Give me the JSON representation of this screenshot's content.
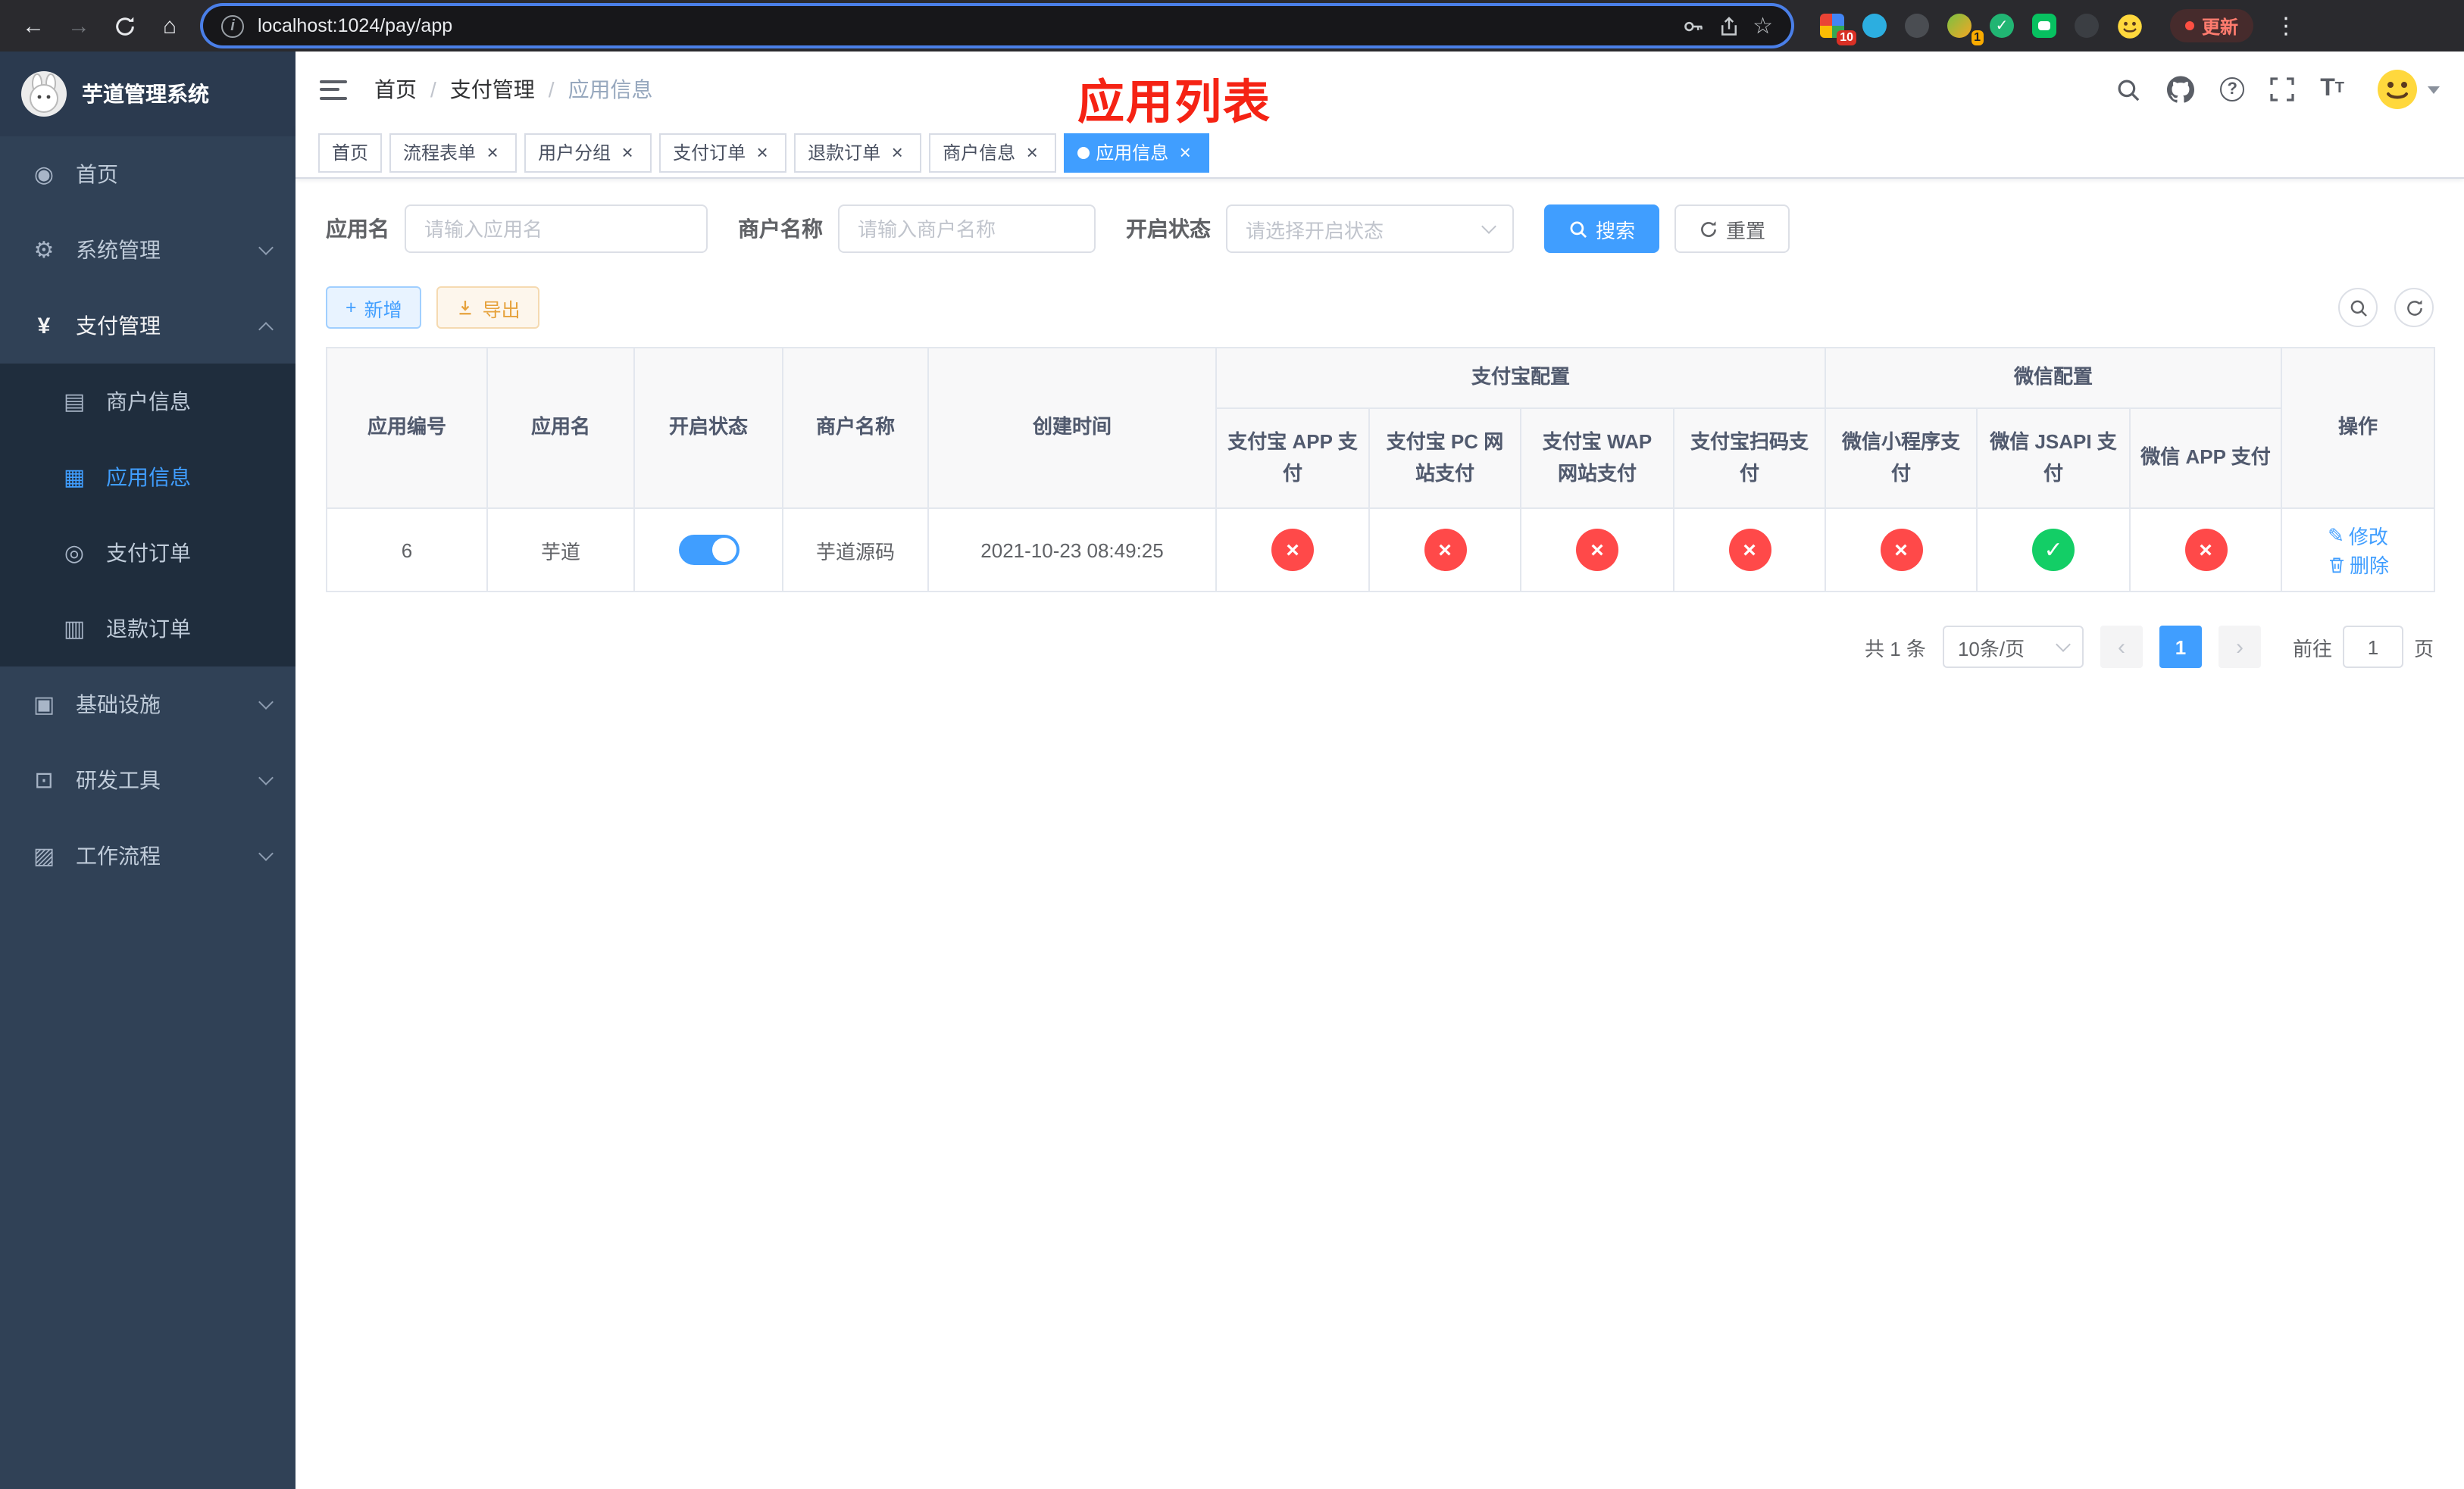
{
  "colors": {
    "accent": "#409eff",
    "danger": "#ff4949",
    "success": "#13ce66",
    "annotation_red": "#f52314",
    "sidebar_bg": "#304156"
  },
  "browser": {
    "url": "localhost:1024/pay/app",
    "update_label": "更新",
    "extension_badge_count": "10",
    "avatar_badge_count": "1"
  },
  "sidebar": {
    "title": "芋道管理系统",
    "home": "首页",
    "system": "系统管理",
    "payment": "支付管理",
    "merchant_info": "商户信息",
    "app_info": "应用信息",
    "pay_order": "支付订单",
    "refund_order": "退款订单",
    "infra": "基础设施",
    "dev_tools": "研发工具",
    "workflow": "工作流程"
  },
  "header": {
    "breadcrumb": [
      "首页",
      "支付管理",
      "应用信息"
    ],
    "annotation": "应用列表"
  },
  "tabs": [
    {
      "label": "首页",
      "closable": false,
      "active": false
    },
    {
      "label": "流程表单",
      "closable": true,
      "active": false
    },
    {
      "label": "用户分组",
      "closable": true,
      "active": false
    },
    {
      "label": "支付订单",
      "closable": true,
      "active": false
    },
    {
      "label": "退款订单",
      "closable": true,
      "active": false
    },
    {
      "label": "商户信息",
      "closable": true,
      "active": false
    },
    {
      "label": "应用信息",
      "closable": true,
      "active": true
    }
  ],
  "filters": {
    "app_name_label": "应用名",
    "app_name_placeholder": "请输入应用名",
    "merchant_label": "商户名称",
    "merchant_placeholder": "请输入商户名称",
    "status_label": "开启状态",
    "status_placeholder": "请选择开启状态",
    "search_label": "搜索",
    "reset_label": "重置"
  },
  "toolbar": {
    "add_label": "新增",
    "export_label": "导出"
  },
  "table": {
    "groups": {
      "alipay": "支付宝配置",
      "wechat": "微信配置"
    },
    "columns": {
      "app_id": "应用编号",
      "app_name": "应用名",
      "status": "开启状态",
      "merchant": "商户名称",
      "created": "创建时间",
      "alipay_app": "支付宝 APP 支付",
      "alipay_pc": "支付宝 PC 网站支付",
      "alipay_wap": "支付宝 WAP 网站支付",
      "alipay_qr": "支付宝扫码支付",
      "wx_mini": "微信小程序支付",
      "wx_jsapi": "微信 JSAPI 支付",
      "wx_app": "微信 APP 支付",
      "actions": "操作"
    },
    "rows": [
      {
        "app_id": "6",
        "app_name": "芋道",
        "status_on": true,
        "merchant": "芋道源码",
        "created": "2021-10-23 08:49:25",
        "configs": [
          "no",
          "no",
          "no",
          "no",
          "no",
          "yes",
          "no"
        ],
        "edit_label": "修改",
        "delete_label": "删除"
      }
    ]
  },
  "pagination": {
    "total_text": "共 1 条",
    "page_size": "10条/页",
    "current_page": "1",
    "goto_prefix": "前往",
    "goto_value": "1",
    "goto_suffix": "页"
  }
}
